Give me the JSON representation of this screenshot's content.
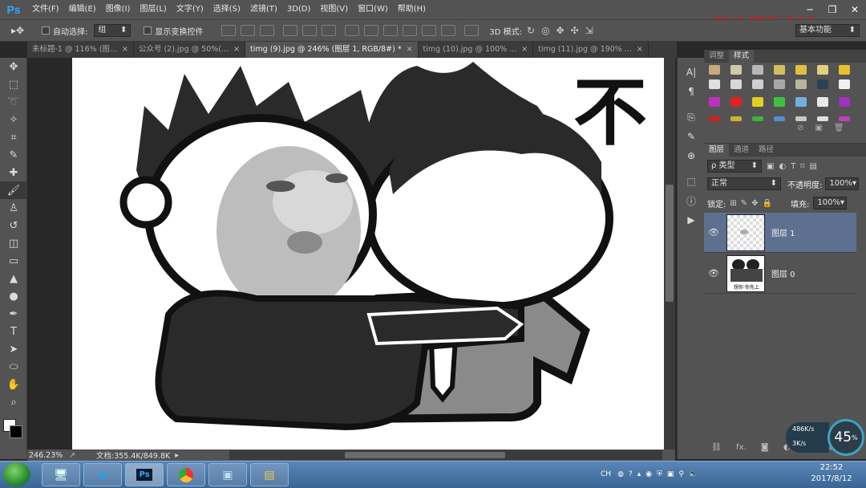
{
  "app": {
    "logo": "Ps"
  },
  "menu": [
    "文件(F)",
    "编辑(E)",
    "图像(I)",
    "图层(L)",
    "文字(Y)",
    "选择(S)",
    "滤镜(T)",
    "3D(D)",
    "视图(V)",
    "窗口(W)",
    "帮助(H)"
  ],
  "watermark": "石头团队制作",
  "options": {
    "auto_select_label": "自动选择:",
    "auto_select_value": "组",
    "show_transform_label": "显示变换控件",
    "mode_3d_label": "3D 模式:",
    "workspace_value": "基本功能"
  },
  "tabs": [
    {
      "label": "未标题-1 @ 116% (图...",
      "active": false
    },
    {
      "label": "公众号 (2).jpg @ 50%(...",
      "active": false
    },
    {
      "label": "timg (9).jpg @ 246% (图层 1, RGB/8#) *",
      "active": true
    },
    {
      "label": "timg (10).jpg @ 100% ...",
      "active": false
    },
    {
      "label": "timg (11).jpg @ 190% ...",
      "active": false
    }
  ],
  "canvas": {
    "text_glyph": "不"
  },
  "status": {
    "zoom": "246.23%",
    "doc_info": "文档:355.4K/849.8K"
  },
  "styles_panel": {
    "tabs": [
      "调整",
      "样式"
    ],
    "active_tab": "样式"
  },
  "layers_panel": {
    "tabs": [
      "图层",
      "通道",
      "路径"
    ],
    "filter_type": "ρ 类型",
    "blend_mode": "正常",
    "opacity_label": "不透明度:",
    "opacity_value": "100%",
    "lock_label": "锁定:",
    "fill_label": "填充:",
    "fill_value": "100%",
    "layers": [
      {
        "name": "图层 1",
        "selected": true
      },
      {
        "name": "图层 0",
        "selected": false
      }
    ],
    "layer0_thumb_caption": "想你·你先上"
  },
  "network": {
    "upload": "486K/s",
    "download": "3K/s",
    "percent": "45",
    "percent_unit": "%"
  },
  "taskbar": {
    "tray_text": "CH",
    "time": "22:52",
    "date": "2017/8/12"
  },
  "colors": {
    "ps_blue": "#31a8ff",
    "watermark_red": "#e01010",
    "selected_layer": "#5d708f"
  }
}
